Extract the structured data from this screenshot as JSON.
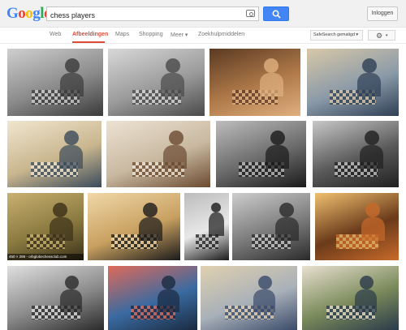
{
  "header": {
    "logo_letters": [
      {
        "ch": "G",
        "color": "#4285f4"
      },
      {
        "ch": "o",
        "color": "#ea4335"
      },
      {
        "ch": "o",
        "color": "#fbbc05"
      },
      {
        "ch": "g",
        "color": "#4285f4"
      },
      {
        "ch": "l",
        "color": "#34a853"
      },
      {
        "ch": "e",
        "color": "#ea4335"
      }
    ],
    "search_value": "chess players",
    "signin_label": "Inloggen"
  },
  "nav": {
    "items": [
      "Web",
      "Afbeeldingen",
      "Maps",
      "Shopping",
      "Meer ▾",
      "Zoekhulpmiddelen"
    ],
    "active": "Afbeeldingen",
    "safesearch": "SafeSearch gematigd ▾",
    "settings_caret": "▾"
  },
  "results": {
    "rows": [
      {
        "tiles": [
          {
            "tone": "bw",
            "colors": [
              "#8a8a8a",
              "#3a3a3a",
              "#cfcfcf"
            ]
          },
          {
            "tone": "bw",
            "colors": [
              "#9a9a9a",
              "#4a4a4a",
              "#d8d8d8"
            ]
          },
          {
            "tone": "warm",
            "colors": [
              "#b07a4a",
              "#e0b080",
              "#5a3a22"
            ]
          },
          {
            "tone": "color",
            "colors": [
              "#8b9aa8",
              "#2f3f55",
              "#d8c8a8"
            ]
          }
        ]
      },
      {
        "tiles": [
          {
            "tone": "color",
            "colors": [
              "#c9b68e",
              "#3a4a5a",
              "#f0e6d0"
            ]
          },
          {
            "tone": "warm",
            "colors": [
              "#c8b8a0",
              "#6a4a30",
              "#ede3d3"
            ]
          },
          {
            "tone": "bw",
            "colors": [
              "#6a6a6a",
              "#1a1a1a",
              "#bdbdbd"
            ]
          },
          {
            "tone": "bw",
            "colors": [
              "#5a5a5a",
              "#1f1f1f",
              "#c8c8c8"
            ]
          }
        ]
      },
      {
        "tiles": [
          {
            "tone": "warm",
            "colors": [
              "#8a7a40",
              "#3a3018",
              "#c8b070"
            ],
            "caption": "450 × 299 - orbglobechessclub.com"
          },
          {
            "tone": "warm",
            "colors": [
              "#c8a060",
              "#1a1a1a",
              "#f0d8a8"
            ]
          },
          {
            "tone": "bw",
            "colors": [
              "#e8e8e8",
              "#1a1a1a",
              "#bcbcbc"
            ]
          },
          {
            "tone": "bw",
            "colors": [
              "#7a7a7a",
              "#2a2a2a",
              "#cdcdcd"
            ]
          },
          {
            "tone": "warm",
            "colors": [
              "#6a3a1a",
              "#c86a2a",
              "#f0c070"
            ]
          }
        ]
      },
      {
        "tiles": [
          {
            "tone": "bw",
            "colors": [
              "#8a8a8a",
              "#2a2a2a",
              "#e0e0e0"
            ]
          },
          {
            "tone": "color",
            "colors": [
              "#3a6aa0",
              "#1a2a40",
              "#e06a5a"
            ]
          },
          {
            "tone": "color",
            "colors": [
              "#a8b0b8",
              "#3a4a6a",
              "#e0d0b0"
            ]
          },
          {
            "tone": "color",
            "colors": [
              "#7a8a5a",
              "#2a3a4a",
              "#e8e0d0"
            ]
          }
        ]
      }
    ]
  }
}
